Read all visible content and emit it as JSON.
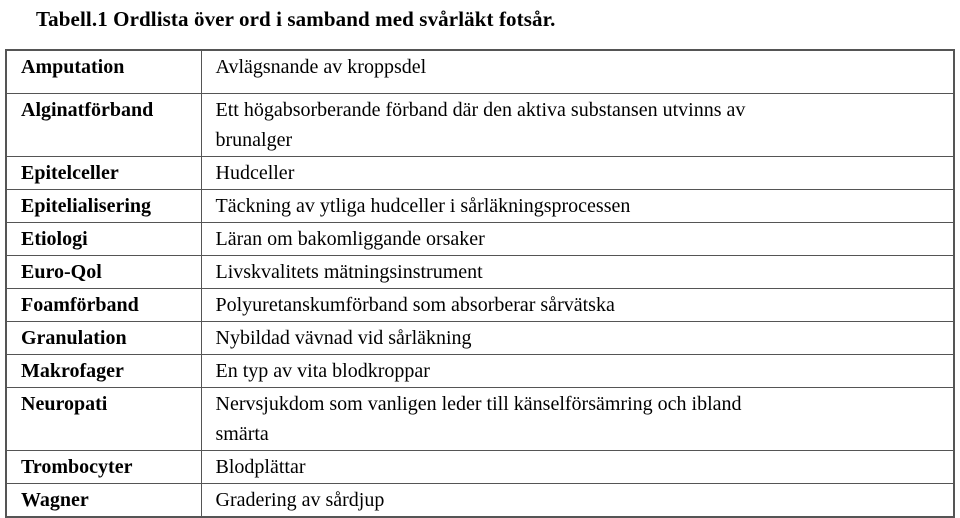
{
  "caption": "Tabell.1 Ordlista över ord i samband med svårläkt fotsår.",
  "table": {
    "rows": [
      {
        "term": "Amputation",
        "definition_lines": [
          "Avlägsnande av kroppsdel"
        ],
        "height": "tall"
      },
      {
        "term": "Alginatförband",
        "definition_lines": [
          "Ett högabsorberande förband där den aktiva substansen utvinns av",
          "brunalger"
        ],
        "height": "wrap"
      },
      {
        "term": "Epitelceller",
        "definition_lines": [
          "Hudceller"
        ],
        "height": "normal"
      },
      {
        "term": "Epitelialisering",
        "definition_lines": [
          "Täckning av ytliga hudceller i sårläkningsprocessen"
        ],
        "height": "normal"
      },
      {
        "term": "Etiologi",
        "definition_lines": [
          "Läran om bakomliggande orsaker"
        ],
        "height": "normal"
      },
      {
        "term": "Euro-Qol",
        "definition_lines": [
          "Livskvalitets mätningsinstrument"
        ],
        "height": "normal"
      },
      {
        "term": "Foamförband",
        "definition_lines": [
          "Polyuretanskumförband som absorberar sårvätska"
        ],
        "height": "normal"
      },
      {
        "term": "Granulation",
        "definition_lines": [
          "Nybildad vävnad vid sårläkning"
        ],
        "height": "normal"
      },
      {
        "term": "Makrofager",
        "definition_lines": [
          "En typ av vita blodkroppar"
        ],
        "height": "normal"
      },
      {
        "term": "Neuropati",
        "definition_lines": [
          "Nervsjukdom som vanligen leder till känselförsämring och ibland",
          "smärta"
        ],
        "height": "wrap"
      },
      {
        "term": "Trombocyter",
        "definition_lines": [
          "Blodplättar"
        ],
        "height": "normal"
      },
      {
        "term": "Wagner",
        "definition_lines": [
          "Gradering av sårdjup"
        ],
        "height": "normal"
      }
    ]
  },
  "colors": {
    "text": "#000000",
    "border": "#555555",
    "background": "#ffffff"
  }
}
